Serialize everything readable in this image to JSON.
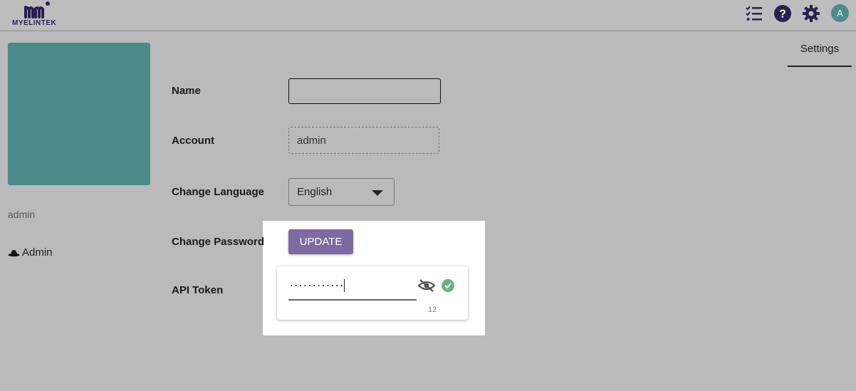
{
  "header": {
    "logo_text": "MYELINTEK",
    "icons": [
      "checklist-icon",
      "help-icon",
      "gear-icon"
    ],
    "avatar_initial": "A"
  },
  "profile": {
    "name": "admin",
    "role": "Admin",
    "role_icon": "hat-icon"
  },
  "tabs": [
    {
      "label": "Settings",
      "active": true
    }
  ],
  "form": {
    "name_label": "Name",
    "name_value": "",
    "account_label": "Account",
    "account_value": "admin",
    "language_label": "Change Language",
    "language_value": "English",
    "password_label": "Change Password",
    "update_label": "UPDATE",
    "token_label": "API Token",
    "token_value": "············",
    "token_counter": "12"
  },
  "colors": {
    "accent": "#7d6aa0",
    "teal": "#4b8a8b",
    "success": "#6bb27d"
  }
}
